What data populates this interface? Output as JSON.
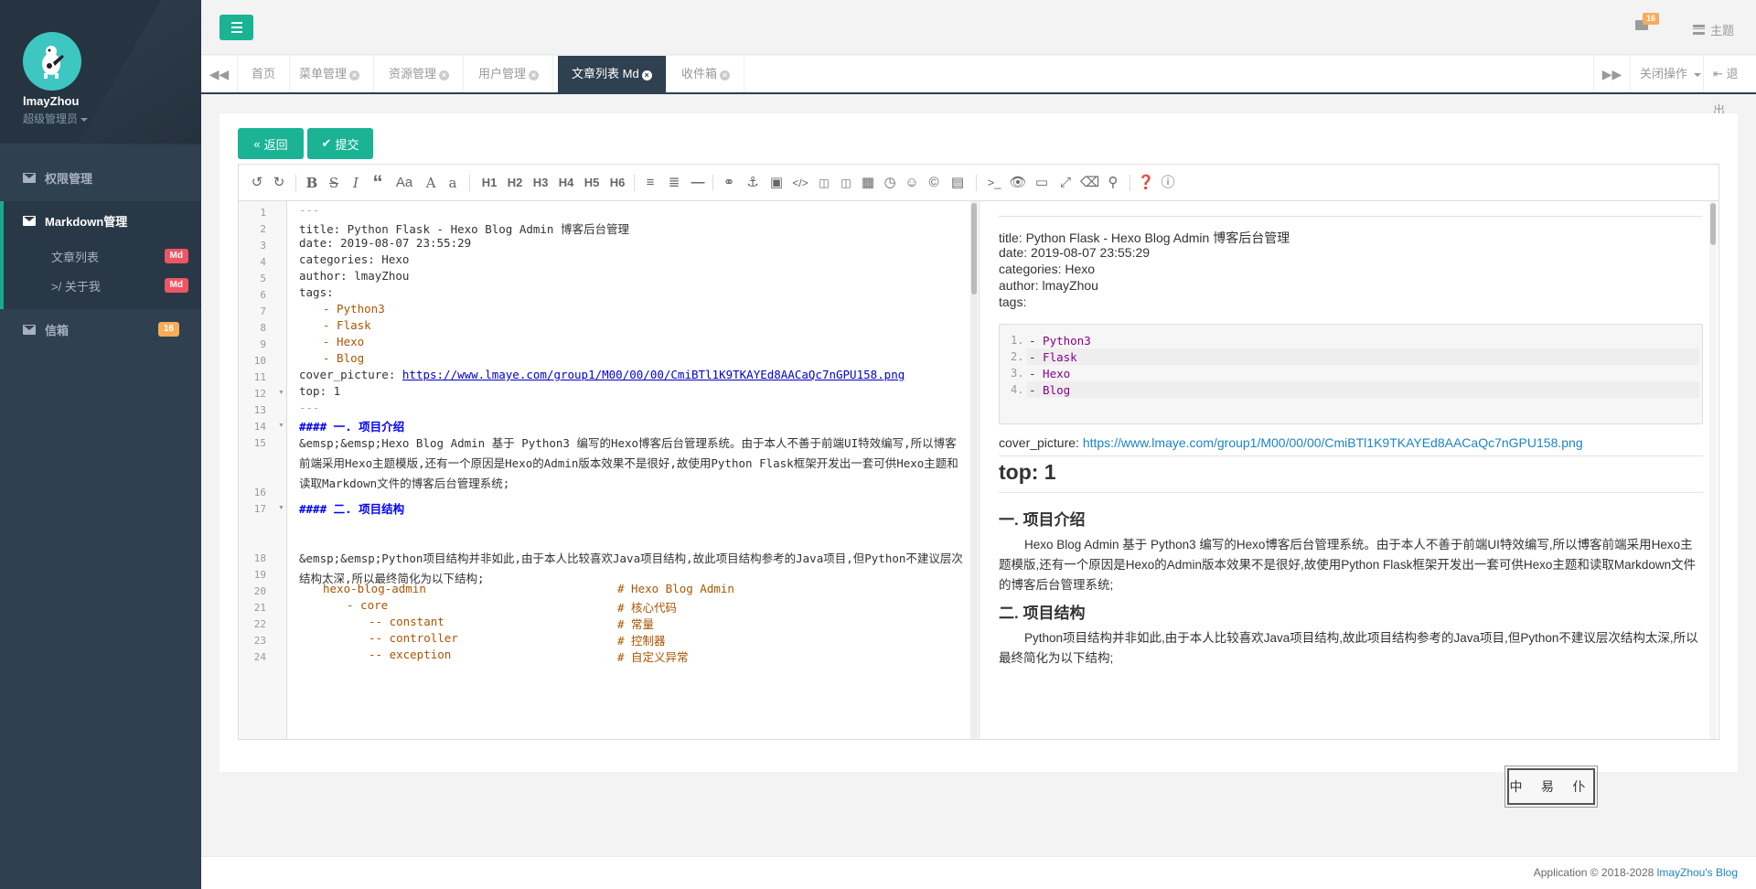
{
  "sidebar": {
    "user_name": "lmayZhou",
    "user_role": "超级管理员",
    "nav": [
      {
        "label": "权限管理"
      },
      {
        "label": "Markdown管理"
      },
      {
        "label": "信箱",
        "badge": "16"
      }
    ],
    "sub_items": [
      {
        "label": "文章列表",
        "badge": "Md"
      },
      {
        "label": ">/ 关于我",
        "badge": "Md"
      }
    ]
  },
  "header": {
    "mail_count": "16",
    "theme_label": "主题"
  },
  "tabs": [
    {
      "label": "首页",
      "closable": false
    },
    {
      "label": "菜单管理",
      "closable": true
    },
    {
      "label": "资源管理",
      "closable": true
    },
    {
      "label": "用户管理",
      "closable": true
    },
    {
      "label": "文章列表 Md",
      "closable": true,
      "active": true
    },
    {
      "label": "收件箱",
      "closable": true
    }
  ],
  "tabs_right": {
    "close_ops": "关闭操作",
    "logout": "退出"
  },
  "actions": {
    "back": "返回",
    "submit": "提交"
  },
  "toolbar": {
    "headings": [
      "H1",
      "H2",
      "H3",
      "H4",
      "H5",
      "H6"
    ]
  },
  "code": {
    "lines": [
      {
        "n": "1",
        "t": "---"
      },
      {
        "n": "2",
        "t": "title: Python Flask - Hexo Blog Admin 博客后台管理"
      },
      {
        "n": "3",
        "t": "date: 2019-08-07 23:55:29"
      },
      {
        "n": "4",
        "t": "categories: Hexo"
      },
      {
        "n": "5",
        "t": "author: lmayZhou"
      },
      {
        "n": "6",
        "t": "tags:"
      },
      {
        "n": "7",
        "t": "- Python3"
      },
      {
        "n": "8",
        "t": "- Flask"
      },
      {
        "n": "9",
        "t": "- Hexo"
      },
      {
        "n": "10",
        "t": "- Blog"
      },
      {
        "n": "11",
        "t": "cover_picture: ",
        "link": "https://www.lmaye.com/group1/M00/00/00/CmiBTl1K9TKAYEd8AACaQc7nGPU158.png"
      },
      {
        "n": "12",
        "t": "top: 1"
      },
      {
        "n": "13",
        "t": "---"
      },
      {
        "n": "14",
        "t": "#### 一. 项目介绍"
      },
      {
        "n": "15",
        "t": "&emsp;&emsp;Hexo Blog Admin 基于 Python3 编写的Hexo博客后台管理系统。由于本人不善于前端UI特效编写,所以博客前端采用Hexo主题模版,还有一个原因是Hexo的Admin版本效果不是很好,故使用Python Flask框架开发出一套可供Hexo主题和读取Markdown文件的博客后台管理系统;"
      },
      {
        "n": "16",
        "t": ""
      },
      {
        "n": "17",
        "t": "#### 二. 项目结构"
      },
      {
        "n": "18",
        "t": "&emsp;&emsp;Python项目结构并非如此,由于本人比较喜欢Java项目结构,故此项目结构参考的Java项目,但Python不建议层次结构太深,所以最终简化为以下结构;"
      },
      {
        "n": "19",
        "t": ""
      },
      {
        "n": "20",
        "t": "hexo-blog-admin",
        "c": "# Hexo Blog Admin"
      },
      {
        "n": "21",
        "t": "- core",
        "c": "# 核心代码"
      },
      {
        "n": "22",
        "t": "-- constant",
        "c": "# 常量"
      },
      {
        "n": "23",
        "t": "-- controller",
        "c": "# 控制器"
      },
      {
        "n": "24",
        "t": "-- exception",
        "c": "# 自定义异常"
      }
    ]
  },
  "preview": {
    "title_line": "title: Python Flask - Hexo Blog Admin 博客后台管理",
    "date_line": "date: 2019-08-07 23:55:29",
    "categories_line": "categories: Hexo",
    "author_line": "author: lmayZhou",
    "tags_line": "tags:",
    "tag_list": [
      {
        "n": "1.",
        "t": "- Python3"
      },
      {
        "n": "2.",
        "t": "- Flask"
      },
      {
        "n": "3.",
        "t": "- Hexo"
      },
      {
        "n": "4.",
        "t": "- Blog"
      }
    ],
    "cover_label": "cover_picture: ",
    "cover_url": "https://www.lmaye.com/group1/M00/00/00/CmiBTl1K9TKAYEd8AACaQc7nGPU158.png",
    "top_heading": "top: 1",
    "h_intro": "一. 项目介绍",
    "p_intro": "Hexo Blog Admin 基于 Python3 编写的Hexo博客后台管理系统。由于本人不善于前端UI特效编写,所以博客前端采用Hexo主题模版,还有一个原因是Hexo的Admin版本效果不是很好,故使用Python Flask框架开发出一套可供Hexo主题和读取Markdown文件的博客后台管理系统;",
    "h_struct": "二. 项目结构",
    "p_struct": "Python项目结构并非如此,由于本人比较喜欢Java项目结构,故此项目结构参考的Java项目,但Python不建议层次结构太深,所以最终简化为以下结构;"
  },
  "stamp": "中 易 仆",
  "footer": {
    "text": "Application © 2018-2028 ",
    "link": "lmayZhou's Blog"
  }
}
